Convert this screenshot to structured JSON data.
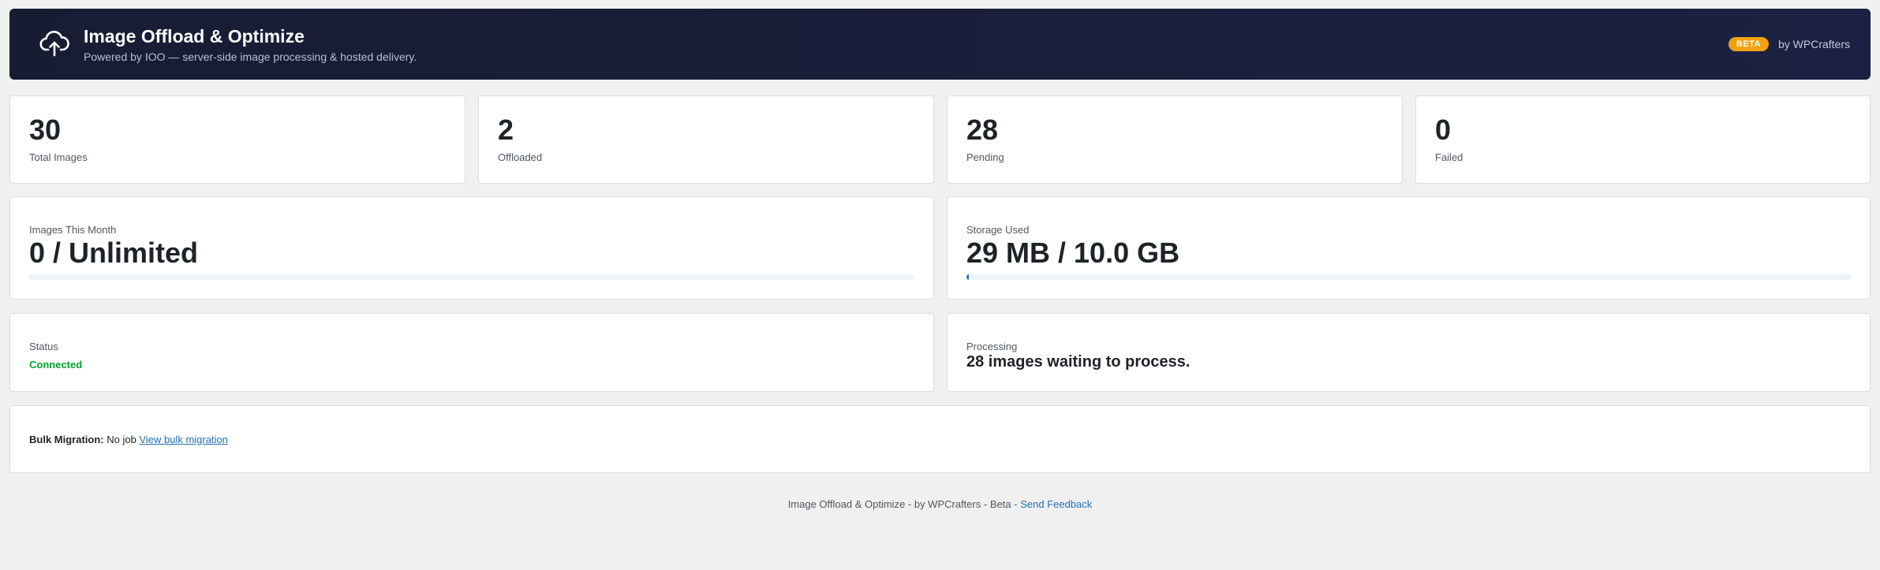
{
  "header": {
    "title": "Image Offload & Optimize",
    "subtitle": "Powered by IOO — server-side image processing & hosted delivery.",
    "badge": "BETA",
    "by": "by WPCrafters",
    "icon": "cloud-upload-icon"
  },
  "stats": [
    {
      "value": "30",
      "label": "Total Images"
    },
    {
      "value": "2",
      "label": "Offloaded"
    },
    {
      "value": "28",
      "label": "Pending"
    },
    {
      "value": "0",
      "label": "Failed"
    }
  ],
  "usage": {
    "images_month": {
      "label": "Images This Month",
      "value": "0 / Unlimited",
      "progress": 0
    },
    "storage": {
      "label": "Storage Used",
      "value": "29 MB / 10.0 GB",
      "progress": 0.003
    }
  },
  "status": {
    "label": "Status",
    "value": "Connected",
    "color": "#00a32a"
  },
  "processing": {
    "label": "Processing",
    "value": "28 images waiting to process."
  },
  "bulk": {
    "label": "Bulk Migration:",
    "value": "No job",
    "link": "View bulk migration"
  },
  "footer": {
    "text": "Image Offload & Optimize - by WPCrafters - Beta - ",
    "link": "Send Feedback"
  },
  "colors": {
    "accent": "#2271b1",
    "badge": "#f0a20e",
    "header_bg": "#1b2142",
    "success": "#00a32a"
  }
}
